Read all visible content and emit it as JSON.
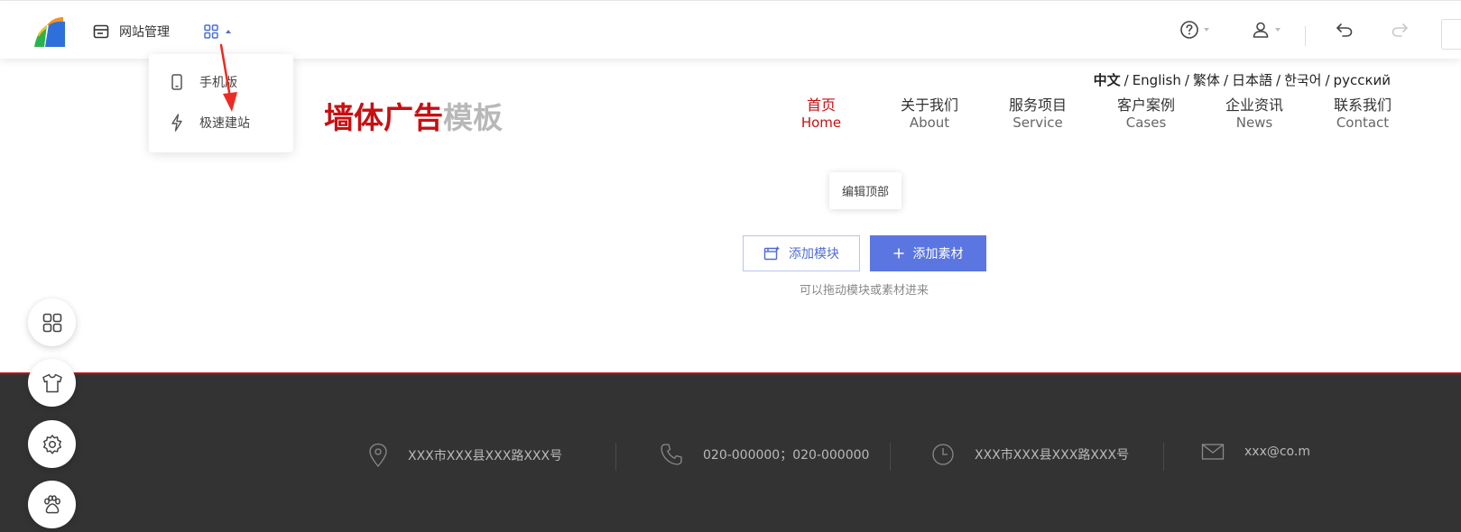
{
  "toolbar": {
    "site_manage_label": "网站管理",
    "help_icon": "question-circle-icon",
    "user_icon": "user-icon",
    "undo_icon": "undo-icon",
    "redo_icon": "redo-icon"
  },
  "dropdown": {
    "items": [
      {
        "label": "手机版",
        "icon": "mobile-icon"
      },
      {
        "label": "极速建站",
        "icon": "lightning-icon"
      }
    ]
  },
  "site": {
    "brand_red": "墙体广告",
    "brand_gray": "模板",
    "languages": [
      "中文",
      "English",
      "繁体",
      "日本語",
      "한국어",
      "русский"
    ],
    "language_separator": "/",
    "nav": [
      {
        "cn": "首页",
        "en": "Home"
      },
      {
        "cn": "关于我们",
        "en": "About"
      },
      {
        "cn": "服务项目",
        "en": "Service"
      },
      {
        "cn": "客户案例",
        "en": "Cases"
      },
      {
        "cn": "企业资讯",
        "en": "News"
      },
      {
        "cn": "联系我们",
        "en": "Contact"
      }
    ]
  },
  "editor": {
    "edit_top_label": "编辑顶部",
    "add_module_label": "添加模块",
    "add_material_label": "添加素材",
    "hint": "可以拖动模块或素材进来"
  },
  "footer": {
    "address": "XXX市XXX县XXX路XXX号",
    "phone": "020-000000；020-000000",
    "address2": "XXX市XXX县XXX路XXX号",
    "email": "xxx@co.m"
  },
  "colors": {
    "brand_red": "#c80f12",
    "accent_blue": "#5b76e0",
    "footer_bg": "#333333"
  }
}
